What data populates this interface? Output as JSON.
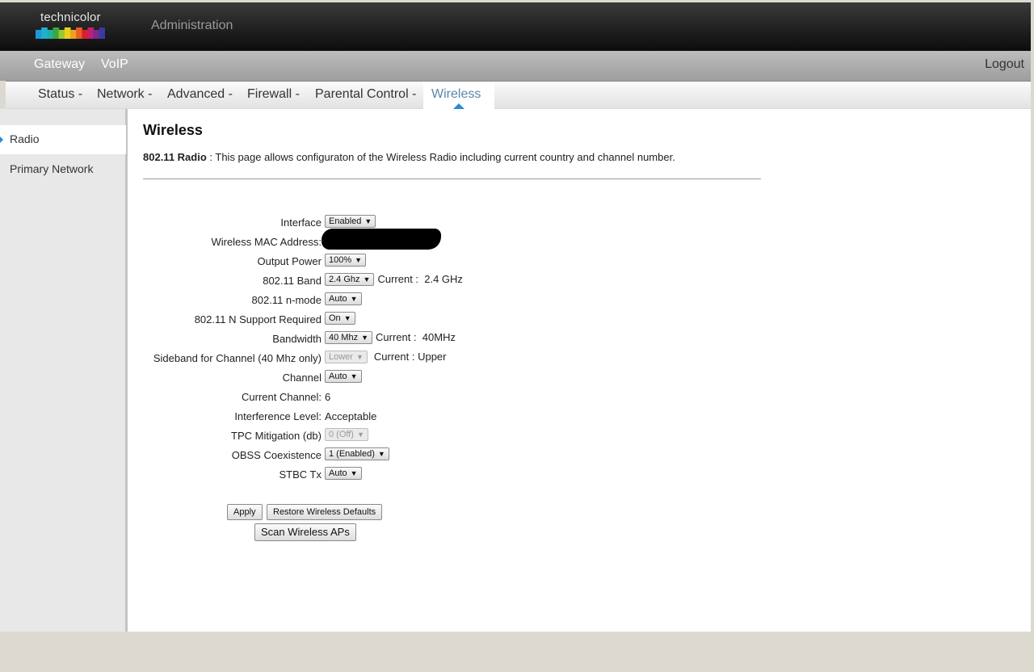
{
  "brand": {
    "name": "technicolor",
    "colors": [
      "#1a9ad8",
      "#1fb0d0",
      "#21b2a0",
      "#3aa840",
      "#9ac830",
      "#e8d020",
      "#f0a020",
      "#e86020",
      "#d82030",
      "#c02070",
      "#7a2a90",
      "#3a3aa0"
    ]
  },
  "header": {
    "title": "Administration"
  },
  "topnav": {
    "items": [
      {
        "label": "Gateway"
      },
      {
        "label": "VoIP"
      }
    ],
    "logout": "Logout"
  },
  "subnav": {
    "items": [
      {
        "label": "Status -"
      },
      {
        "label": "Network -"
      },
      {
        "label": "Advanced -"
      },
      {
        "label": "Firewall -"
      },
      {
        "label": "Parental Control -"
      }
    ],
    "active": "Wireless"
  },
  "sidebar": {
    "items": [
      {
        "label": "Radio"
      },
      {
        "label": "Primary Network"
      }
    ]
  },
  "main": {
    "title": "Wireless",
    "desc_label": "802.11 Radio",
    "desc_sep": " : ",
    "desc_text": "This page allows configuraton of the Wireless Radio including current country and channel number."
  },
  "form": {
    "interface": {
      "label": "Interface",
      "value": "Enabled"
    },
    "mac": {
      "label": "Wireless MAC Address:"
    },
    "output_power": {
      "label": "Output Power",
      "value": "100%"
    },
    "band": {
      "label": "802.11 Band",
      "value": "2.4 Ghz",
      "current": "Current :  2.4 GHz"
    },
    "nmode": {
      "label": "802.11 n-mode",
      "value": "Auto"
    },
    "n_support": {
      "label": "802.11 N Support Required",
      "value": "On"
    },
    "bandwidth": {
      "label": "Bandwidth",
      "value": "40 Mhz",
      "current": "Current :  40MHz"
    },
    "sideband": {
      "label": "Sideband for Channel (40 Mhz only)",
      "value": "Lower",
      "current": "Current : Upper"
    },
    "channel": {
      "label": "Channel",
      "value": "Auto"
    },
    "current_channel": {
      "label": "Current Channel:",
      "value": "6"
    },
    "interference": {
      "label": "Interference Level:",
      "value": "Acceptable"
    },
    "tpc": {
      "label": "TPC Mitigation (db)",
      "value": "0 (Off)"
    },
    "obss": {
      "label": "OBSS Coexistence",
      "value": "1 (Enabled)"
    },
    "stbc": {
      "label": "STBC Tx",
      "value": "Auto"
    }
  },
  "buttons": {
    "apply": "Apply",
    "restore": "Restore Wireless Defaults",
    "scan": "Scan Wireless APs"
  }
}
